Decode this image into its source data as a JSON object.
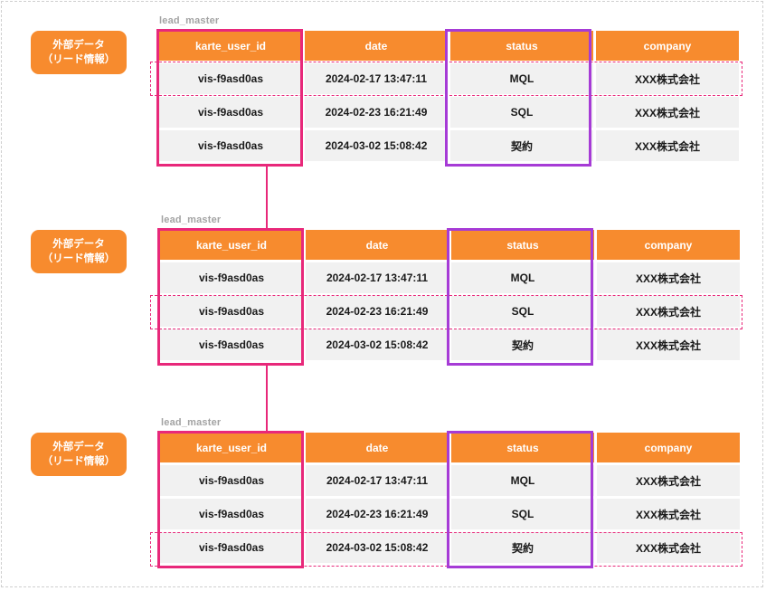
{
  "blocks": [
    {
      "table_name": "lead_master",
      "source_label_line1": "外部データ",
      "source_label_line2": "（リード情報）",
      "columns": [
        "karte_user_id",
        "date",
        "status",
        "company"
      ],
      "rows": [
        [
          "vis-f9asd0as",
          "2024-02-17 13:47:11",
          "MQL",
          "XXX株式会社"
        ],
        [
          "vis-f9asd0as",
          "2024-02-23 16:21:49",
          "SQL",
          "XXX株式会社"
        ],
        [
          "vis-f9asd0as",
          "2024-03-02 15:08:42",
          "契約",
          "XXX株式会社"
        ]
      ],
      "highlighted_row": 0
    },
    {
      "table_name": "lead_master",
      "source_label_line1": "外部データ",
      "source_label_line2": "（リード情報）",
      "columns": [
        "karte_user_id",
        "date",
        "status",
        "company"
      ],
      "rows": [
        [
          "vis-f9asd0as",
          "2024-02-17 13:47:11",
          "MQL",
          "XXX株式会社"
        ],
        [
          "vis-f9asd0as",
          "2024-02-23 16:21:49",
          "SQL",
          "XXX株式会社"
        ],
        [
          "vis-f9asd0as",
          "2024-03-02 15:08:42",
          "契約",
          "XXX株式会社"
        ]
      ],
      "highlighted_row": 1
    },
    {
      "table_name": "lead_master",
      "source_label_line1": "外部データ",
      "source_label_line2": "（リード情報）",
      "columns": [
        "karte_user_id",
        "date",
        "status",
        "company"
      ],
      "rows": [
        [
          "vis-f9asd0as",
          "2024-02-17 13:47:11",
          "MQL",
          "XXX株式会社"
        ],
        [
          "vis-f9asd0as",
          "2024-02-23 16:21:49",
          "SQL",
          "XXX株式会社"
        ],
        [
          "vis-f9asd0as",
          "2024-03-02 15:08:42",
          "契約",
          "XXX株式会社"
        ]
      ],
      "highlighted_row": 2
    }
  ],
  "colors": {
    "header_orange": "#f78b2e",
    "cell_gray": "#f1f1f1",
    "id_box_pink": "#e8287a",
    "status_box_purple": "#a63bd6"
  }
}
